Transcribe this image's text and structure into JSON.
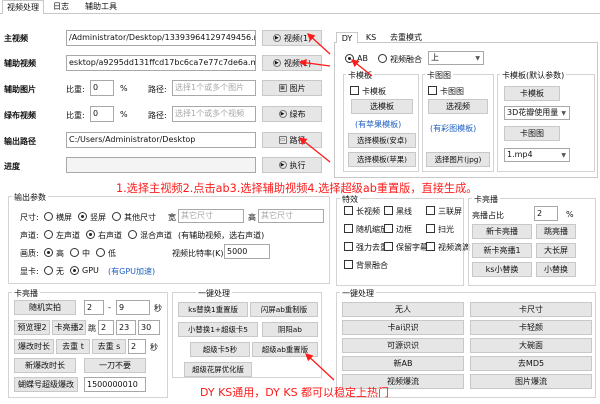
{
  "tabs": [
    "视频处理",
    "日志",
    "辅助工具"
  ],
  "main_video": {
    "label": "主视频",
    "value": "/Administrator/Desktop/13393964129749456.mp4",
    "button": "视频(1)"
  },
  "aux_video": {
    "label": "辅助视频",
    "value": "esktop/a9295dd131ffcd17bc6ca7e77c7de6a.mp4",
    "button": "视频(1)"
  },
  "aux_image": {
    "label": "辅助图片",
    "ratio_label": "比重:",
    "ratio": "0",
    "unit": "%",
    "path_label": "路径:",
    "placeholder": "选择1个或多个图片",
    "button": "图片"
  },
  "green_video": {
    "label": "绿布视频",
    "ratio_label": "比重:",
    "ratio": "0",
    "unit": "%",
    "path_label": "路径:",
    "placeholder": "选择1个或多个视频",
    "button": "绿布"
  },
  "output_path": {
    "label": "输出路径",
    "value": "C:/Users/Administrator/Desktop",
    "button": "路径"
  },
  "progress": {
    "label": "进度",
    "button": "执行"
  },
  "right_tabs": [
    "DY",
    "KS",
    "去重模式"
  ],
  "mode": {
    "ab": "AB",
    "fusion": "视频融合",
    "dropdown": "上"
  },
  "panel_card_template": {
    "title": "卡模板",
    "checkbox": "卡模板",
    "select_btn": "选模板",
    "apple_note": "(有苹果模板)",
    "select_android": "选择模板(安卓)",
    "select_apple": "选择模板(苹果)"
  },
  "panel_card_image": {
    "title": "卡图图",
    "checkbox": "卡图图",
    "select_btn": "选视频",
    "note": "(有彩图模板)",
    "select_jpg": "选择图片(jpg)"
  },
  "panel_default": {
    "title": "卡模板(默认参数)",
    "card_btn": "卡模板",
    "dropdown1": "3D花瓣使用量",
    "card_img_btn": "卡图图",
    "dropdown2": "1.mp4"
  },
  "annotation_top": "1.选择主视频2.点击ab3.选择辅助视频4.选择超级ab重置版，直接生成。",
  "annotation_bottom": "DY KS通用，DY KS 都可以稳定上热门",
  "output_params": {
    "title": "输出参数",
    "size_label": "尺寸:",
    "size_options": [
      "横屏",
      "竖屏",
      "其他尺寸"
    ],
    "width_label": "宽",
    "width_placeholder": "其它尺寸",
    "height_label": "高",
    "height_placeholder": "其它尺寸",
    "audio_label": "声道:",
    "audio_options": [
      "左声道",
      "右声道",
      "混合声道"
    ],
    "audio_note": "(有辅助视频，选右声道)",
    "quality_label": "画质:",
    "quality_options": [
      "高",
      "中",
      "低"
    ],
    "bitrate_label": "视频比特率(K)",
    "bitrate": "5000",
    "gpu_label": "显卡:",
    "gpu_options": [
      "无",
      "GPU"
    ],
    "gpu_note": "(有GPU加速)"
  },
  "effects": {
    "title": "特效",
    "items": [
      [
        "长视频",
        "黑线",
        "三联屏"
      ],
      [
        "随机缩放",
        "边框",
        "扫光"
      ],
      [
        "强力去重",
        "保留字幕",
        "视频滴滴"
      ],
      [
        "背景融合"
      ]
    ]
  },
  "card_box": {
    "title": "卡亮播",
    "brightness_label": "亮播占比",
    "brightness": "2",
    "unit": "%",
    "buttons": [
      "新卡亮播",
      "跳亮播",
      "新卡亮播1",
      "大长屏",
      "ks小替换",
      "小替换"
    ]
  },
  "card_boost": {
    "title": "卡亮播",
    "random_btn": "随机实拍",
    "v1": "2",
    "v2": "9",
    "unit": "秒",
    "preview_btn": "预览理2",
    "card_boost2": "卡亮播2",
    "jump_label": "跳",
    "v3": "2",
    "v4": "23",
    "v5": "30",
    "flip_btn": "爆改时长",
    "go_t_btn": "去重 t",
    "go_s_btn": "去重 s",
    "v6": "2",
    "new_flip_btn": "新爆改时长",
    "cut_btn": "一刀不要",
    "butterfly_btn": "蝴蝶号超级爆改",
    "v7": "1500000010"
  },
  "one_click_a": {
    "title": "一键处理",
    "buttons": [
      "ks替换1重置版",
      "闪屏ab重制版",
      "小替换1+超级卡5",
      "阴阳ab",
      "超级卡5秒",
      "超级ab重置版",
      "超级花屏优化版"
    ]
  },
  "one_click_b": {
    "title": "一键处理",
    "buttons": [
      "无人",
      "卡尺寸",
      "卡ai识识",
      "卡轻颜",
      "可源识识",
      "大碗面",
      "新AB",
      "去MD5",
      "视频爆流",
      "图片爆流"
    ]
  },
  "colors": {
    "annotation": "#ff1a1a",
    "link_blue": "#1d5fc4",
    "button_bg": "#e6e6e6"
  }
}
